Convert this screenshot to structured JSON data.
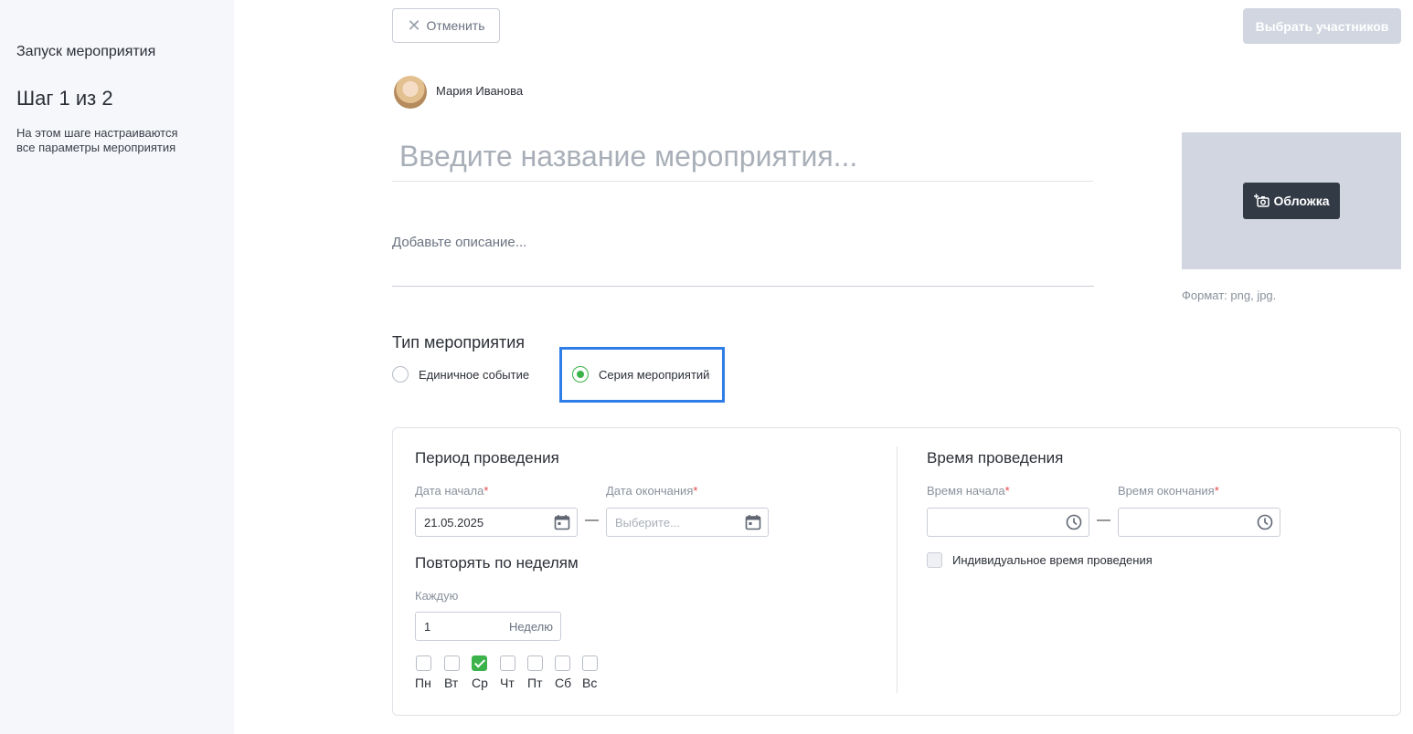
{
  "sidebar": {
    "title": "Запуск мероприятия",
    "step": "Шаг 1 из 2",
    "description": "На этом шаге настраиваются все параметры мероприятия"
  },
  "toolbar": {
    "cancel_label": "Отменить",
    "select_participants_label": "Выбрать участников"
  },
  "author": {
    "name": "Мария Иванова"
  },
  "event": {
    "title_placeholder": "Введите название мероприятия...",
    "description_placeholder": "Добавьте описание...",
    "cover_button": "Обложка",
    "cover_format": "Формат: png, jpg."
  },
  "event_type": {
    "label": "Тип мероприятия",
    "options": [
      {
        "label": "Единичное событие",
        "selected": false
      },
      {
        "label": "Серия мероприятий",
        "selected": true
      }
    ]
  },
  "period": {
    "heading": "Период проведения",
    "start_label": "Дата начала",
    "start_value": "21.05.2025",
    "end_label": "Дата окончания",
    "end_placeholder": "Выберите...",
    "required_mark": "*",
    "dash": "—"
  },
  "repeat": {
    "heading": "Повторять по неделям",
    "every_label": "Каждую",
    "every_value": "1",
    "every_suffix": "Неделю",
    "days": [
      {
        "label": "Пн",
        "checked": false
      },
      {
        "label": "Вт",
        "checked": false
      },
      {
        "label": "Ср",
        "checked": true
      },
      {
        "label": "Чт",
        "checked": false
      },
      {
        "label": "Пт",
        "checked": false
      },
      {
        "label": "Сб",
        "checked": false
      },
      {
        "label": "Вс",
        "checked": false
      }
    ]
  },
  "time": {
    "heading": "Время проведения",
    "start_label": "Время начала",
    "end_label": "Время окончания",
    "individual_label": "Индивидуальное время проведения",
    "individual_checked": false
  },
  "colors": {
    "accent_green": "#3bb34a",
    "focus_blue": "#2f7de6",
    "disabled_button": "#d1d6e0",
    "dark_button": "#323a46",
    "required": "#e5484d"
  },
  "icons": {
    "cancel": "close-icon",
    "cover": "camera-plus-icon",
    "date": "calendar-icon",
    "time": "clock-icon"
  }
}
